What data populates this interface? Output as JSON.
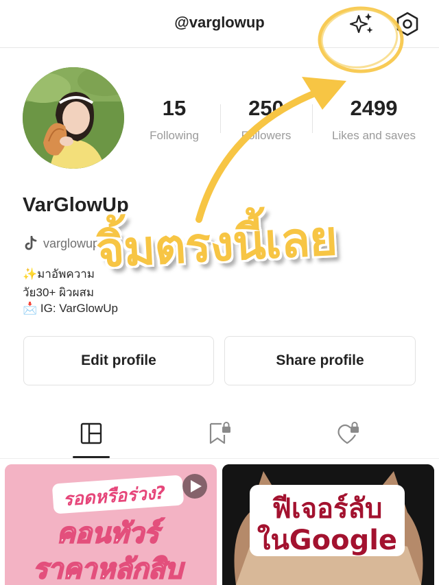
{
  "header": {
    "title": "@varglowup"
  },
  "profile": {
    "display_name": "VarGlowUp",
    "handle": "varglowup",
    "bio": [
      "✨มาอัพความ",
      "วัย30+ ผิวผสม",
      "📩 IG: VarGlowUp"
    ]
  },
  "stats": [
    {
      "value": "15",
      "label": "Following"
    },
    {
      "value": "250",
      "label": "Followers"
    },
    {
      "value": "2499",
      "label": "Likes and saves"
    }
  ],
  "actions": {
    "edit_label": "Edit profile",
    "share_label": "Share profile"
  },
  "tabs": [
    {
      "icon": "grid-icon",
      "active": true
    },
    {
      "icon": "bookmark-lock-icon",
      "active": false
    },
    {
      "icon": "heart-lock-icon",
      "active": false
    }
  ],
  "posts": [
    {
      "lines": [
        "รอดหรือร่วง?",
        "คอนทัวร์",
        "ราคาหลักสิบ"
      ],
      "has_video": true
    },
    {
      "lines": [
        "ฟีเจอร์ลับ",
        "ในGoogle"
      ],
      "has_video": false
    }
  ],
  "overlay": {
    "text": "จิ้มตรงนี้เลย"
  },
  "colors": {
    "accent_yellow": "#f7c544",
    "pink_tile": "#f5b7c6",
    "dark_tile": "#141414"
  }
}
